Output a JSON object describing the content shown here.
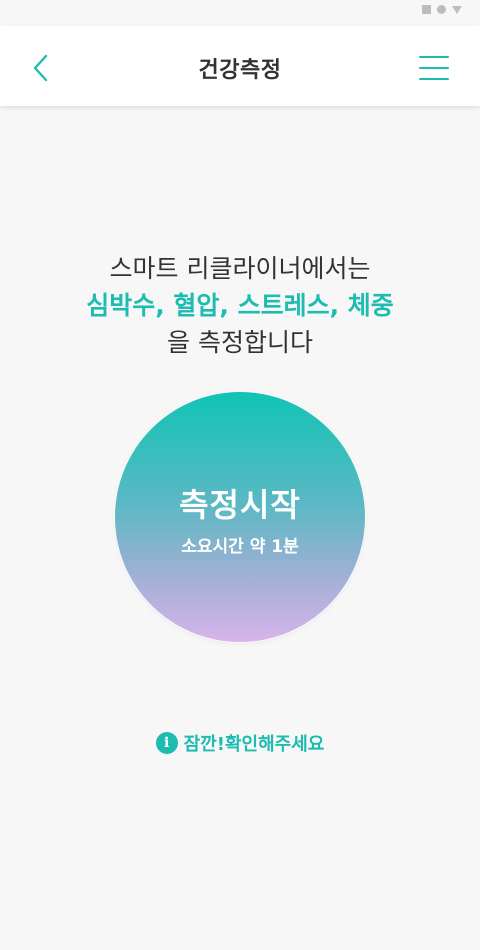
{
  "status_bar": {
    "icons": [
      "square-icon",
      "circle-icon",
      "triangle-icon"
    ]
  },
  "header": {
    "title": "건강측정",
    "back_icon": "chevron-left-icon",
    "menu_icon": "hamburger-menu-icon"
  },
  "intro": {
    "line1": "스마트 리클라이너에서는",
    "line2": "심박수, 혈압, 스트레스, 체중",
    "line3": "을 측정합니다"
  },
  "measure_button": {
    "title": "측정시작",
    "subtitle": "소요시간 약 1분"
  },
  "notice": {
    "icon_glyph": "i",
    "text": "잠깐!확인해주세요"
  },
  "colors": {
    "accent": "#1dbcb0",
    "text": "#333333",
    "background": "#f7f7f7",
    "gradient_top": "#10c4b5",
    "gradient_bottom": "#d7b4ea"
  }
}
